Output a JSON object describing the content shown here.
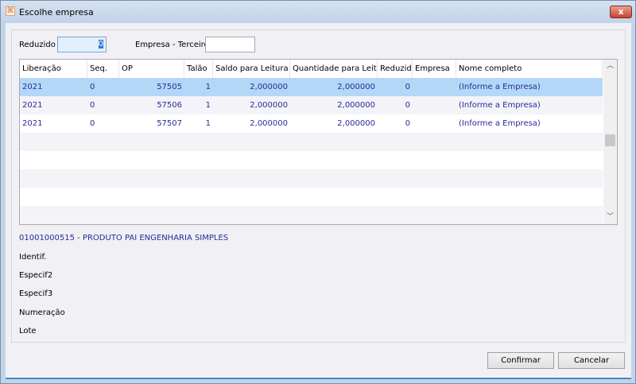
{
  "window": {
    "title": "Escolhe empresa",
    "close_label": "x"
  },
  "filters": {
    "reduzido_label": "Reduzido",
    "reduzido_value": "0",
    "empresa_terceiro_label": "Empresa - Terceiro",
    "empresa_terceiro_value": ""
  },
  "grid": {
    "columns": [
      "Liberação",
      "Seq.",
      "OP",
      "Talão",
      "Saldo para Leitura",
      "Quantidade para Leitura",
      "Reduzido",
      "Empresa",
      "Nome completo"
    ],
    "rows": [
      [
        "2021",
        "0",
        "57505",
        "1",
        "2,000000",
        "2,000000",
        "0",
        "",
        "(Informe a Empresa)"
      ],
      [
        "2021",
        "0",
        "57506",
        "1",
        "2,000000",
        "2,000000",
        "0",
        "",
        "(Informe a Empresa)"
      ],
      [
        "2021",
        "0",
        "57507",
        "1",
        "2,000000",
        "2,000000",
        "0",
        "",
        "(Informe a Empresa)"
      ]
    ],
    "selected_row": 0
  },
  "details": {
    "produto": "01001000515 - PRODUTO PAI ENGENHARIA SIMPLES",
    "identif": "Identif.",
    "especif2": "Especif2",
    "especif3": "Especif3",
    "numeracao": "Numeração",
    "lote": "Lote"
  },
  "buttons": {
    "confirmar": "Confirmar",
    "cancelar": "Cancelar"
  }
}
